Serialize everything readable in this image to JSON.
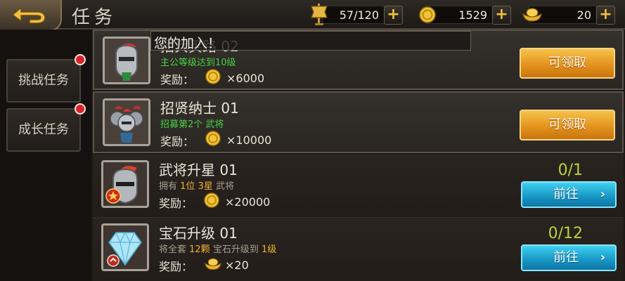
{
  "header": {
    "title": "任务",
    "resources": [
      {
        "name": "stamina",
        "icon": "banner-flag-icon",
        "value": "57/120"
      },
      {
        "name": "gold",
        "icon": "gold-coin-icon",
        "value": "1529"
      },
      {
        "name": "ingot",
        "icon": "gold-ingot-icon",
        "value": "20"
      }
    ]
  },
  "sidebar": {
    "tabs": [
      {
        "label": "挑战任务",
        "badge": true
      },
      {
        "label": "成长任务",
        "badge": true
      }
    ]
  },
  "toast": {
    "text": "您的加入！"
  },
  "tasks": [
    {
      "name": "招兵买马 02",
      "name_visible": "招兵买路 02",
      "desc": "主公等级达到10级",
      "desc_color": "#49d244",
      "reward_label": "奖励：",
      "reward_icon": "gold-coin-icon",
      "reward_amount": "×6000",
      "action": "可领取",
      "state": "claimable"
    },
    {
      "name": "招贤纳士 01",
      "desc": "招募第2个 武将",
      "desc_color": "#49d244",
      "reward_label": "奖励：",
      "reward_icon": "gold-coin-icon",
      "reward_amount": "×10000",
      "action": "可领取",
      "state": "claimable"
    },
    {
      "name": "武将升星 01",
      "desc_parts": [
        "拥有 ",
        "1位",
        " ",
        "3星",
        " 武将"
      ],
      "reward_label": "奖励：",
      "reward_icon": "gold-coin-icon",
      "reward_amount": "×20000",
      "progress": "0/1",
      "action": "前往",
      "state": "in-progress"
    },
    {
      "name": "宝石升级 01",
      "desc_parts": [
        "将全套 ",
        "12颗",
        " 宝石升级到 ",
        "1级"
      ],
      "reward_label": "奖励：",
      "reward_icon": "gold-ingot-icon",
      "reward_amount": "×20",
      "progress": "0/12",
      "action": "前往",
      "state": "in-progress"
    }
  ],
  "colors": {
    "claim_button": "#e2901a",
    "go_button": "#1796c4",
    "progress_text": "#b7d23c",
    "highlight_text": "#f0b238",
    "badge_red": "#d8232b"
  }
}
